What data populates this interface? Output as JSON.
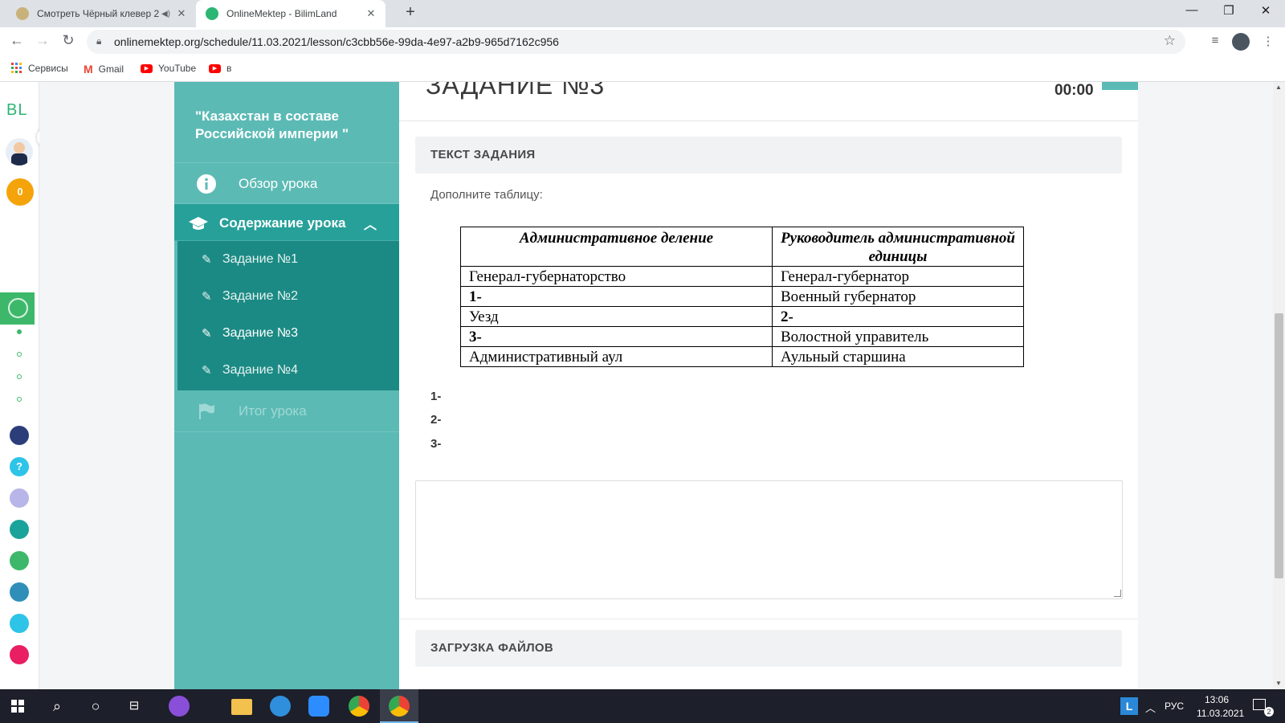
{
  "browser": {
    "tabs": [
      {
        "title": "Смотреть Чёрный клевер 2",
        "active": false,
        "muted": true
      },
      {
        "title": "OnlineMektep - BilimLand",
        "active": true
      }
    ],
    "new_tab_symbol": "+",
    "window_controls": {
      "minimize": "—",
      "restore": "❐",
      "close": "✕"
    },
    "url": "onlinemektep.org/schedule/11.03.2021/lesson/c3cbb56e-99da-4e97-a2b9-965d7162c956",
    "bookmarks": [
      {
        "label": "Сервисы",
        "icon": "apps-grid-icon"
      },
      {
        "label": "Gmail",
        "icon": "gmail-icon"
      },
      {
        "label": "YouTube",
        "icon": "youtube-icon"
      },
      {
        "label": "в",
        "icon": "youtube-icon"
      }
    ]
  },
  "rail": {
    "logo": "BL",
    "points_badge": "0",
    "accent_color": "#3db86b"
  },
  "sidebar": {
    "lesson_title": "\"Казахстан в составе Российской империи \"",
    "overview_label": "Обзор урока",
    "content_label": "Содержание урока",
    "tasks": [
      "Задание №1",
      "Задание №2",
      "Задание №3",
      "Задание №4"
    ],
    "current_task_index": 2,
    "result_label": "Итог урока",
    "color": "#5cbab5"
  },
  "task": {
    "title": "ЗАДАНИЕ №3",
    "timer": "00:00",
    "text_section_label": "ТЕКСТ ЗАДАНИЯ",
    "instruction": "Дополните таблицу:",
    "table": {
      "headers": [
        "Административное деление",
        "Руководитель административной единицы"
      ],
      "rows": [
        [
          "Генерал-губернаторство",
          "Генерал-губернатор"
        ],
        [
          "1-",
          "Военный губернатор"
        ],
        [
          "Уезд",
          "2-"
        ],
        [
          "3-",
          "Волостной управитель"
        ],
        [
          "Административный аул",
          "Аульный старшина"
        ]
      ]
    },
    "answer_labels": [
      "1-",
      "2-",
      "3-"
    ],
    "answer_value": "",
    "upload_section_label": "ЗАГРУЗКА ФАЙЛОВ"
  },
  "taskbar": {
    "language": "РУС",
    "time": "13:06",
    "date": "11.03.2021",
    "notification_count": "2"
  }
}
